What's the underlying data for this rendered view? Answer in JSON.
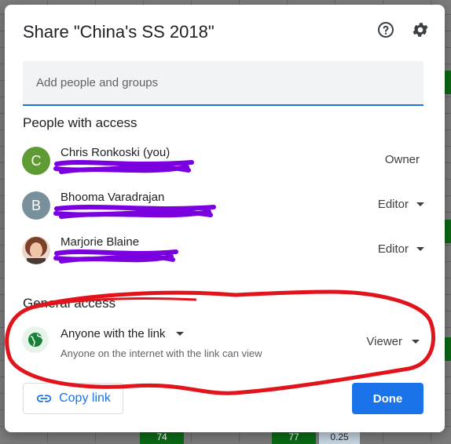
{
  "background": {
    "cells": [
      "74",
      "77",
      "0.25"
    ]
  },
  "dialog": {
    "title": "Share \"China's SS 2018\"",
    "help_icon": "help-circle-icon",
    "settings_icon": "gear-icon",
    "add_people_placeholder": "Add people and groups",
    "people_section_title": "People with access",
    "people": [
      {
        "name": "Chris Ronkoski (you)",
        "initial": "C",
        "avatar_color": "#5e9b34",
        "role": "Owner",
        "has_dropdown": false
      },
      {
        "name": "Bhooma Varadrajan",
        "initial": "B",
        "avatar_color": "#78909c",
        "role": "Editor",
        "has_dropdown": true
      },
      {
        "name": "Marjorie Blaine",
        "initial": "",
        "avatar_color": "#8d5a3b",
        "role": "Editor",
        "has_dropdown": true
      }
    ],
    "general_access_title": "General access",
    "general_access": {
      "icon": "globe-icon",
      "scope": "Anyone with the link",
      "description": "Anyone on the internet with the link can view",
      "role": "Viewer"
    },
    "copy_link_label": "Copy link",
    "done_label": "Done"
  },
  "colors": {
    "accent": "#1a73e8",
    "redaction": "#7a00e0",
    "annotation": "#e1141c"
  }
}
